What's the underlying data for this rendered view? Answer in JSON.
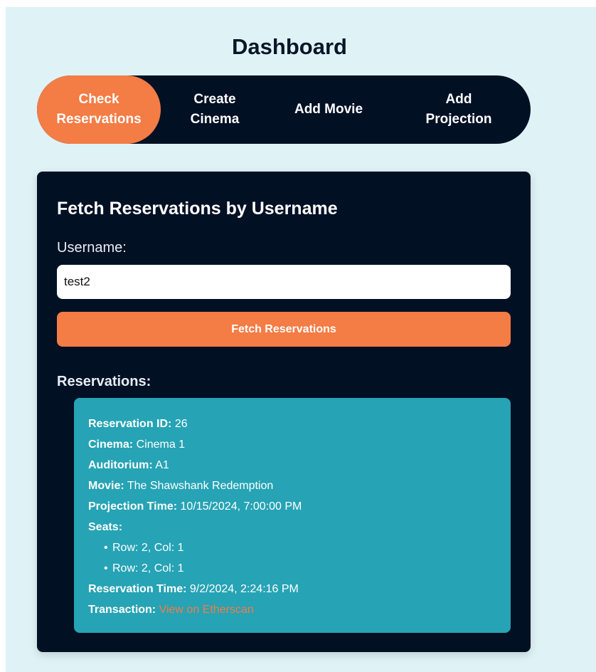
{
  "header": {
    "title": "Dashboard"
  },
  "tabs": [
    {
      "label": "Check\nReservations",
      "active": true
    },
    {
      "label": "Create\nCinema",
      "active": false
    },
    {
      "label": "Add Movie",
      "active": false
    },
    {
      "label": "Add\nProjection",
      "active": false
    }
  ],
  "form": {
    "title": "Fetch Reservations by Username",
    "username_label": "Username:",
    "username_value": "test2",
    "submit_label": "Fetch Reservations"
  },
  "reservations": {
    "heading": "Reservations:",
    "items": [
      {
        "id_label": "Reservation ID:",
        "id": "26",
        "cinema_label": "Cinema:",
        "cinema": "Cinema 1",
        "auditorium_label": "Auditorium:",
        "auditorium": "A1",
        "movie_label": "Movie:",
        "movie": "The Shawshank Redemption",
        "projection_label": "Projection Time:",
        "projection_time": "10/15/2024, 7:00:00 PM",
        "seats_label": "Seats:",
        "seats": [
          "Row: 2, Col: 1",
          "Row: 2, Col: 1"
        ],
        "reservation_time_label": "Reservation Time:",
        "reservation_time": "9/2/2024, 2:24:16 PM",
        "transaction_label": "Transaction:",
        "transaction_link": "View on Etherscan"
      }
    ]
  },
  "colors": {
    "background": "#dff3f7",
    "dark": "#021024",
    "accent": "#f47c45",
    "reservation_card": "#26a3b5"
  }
}
